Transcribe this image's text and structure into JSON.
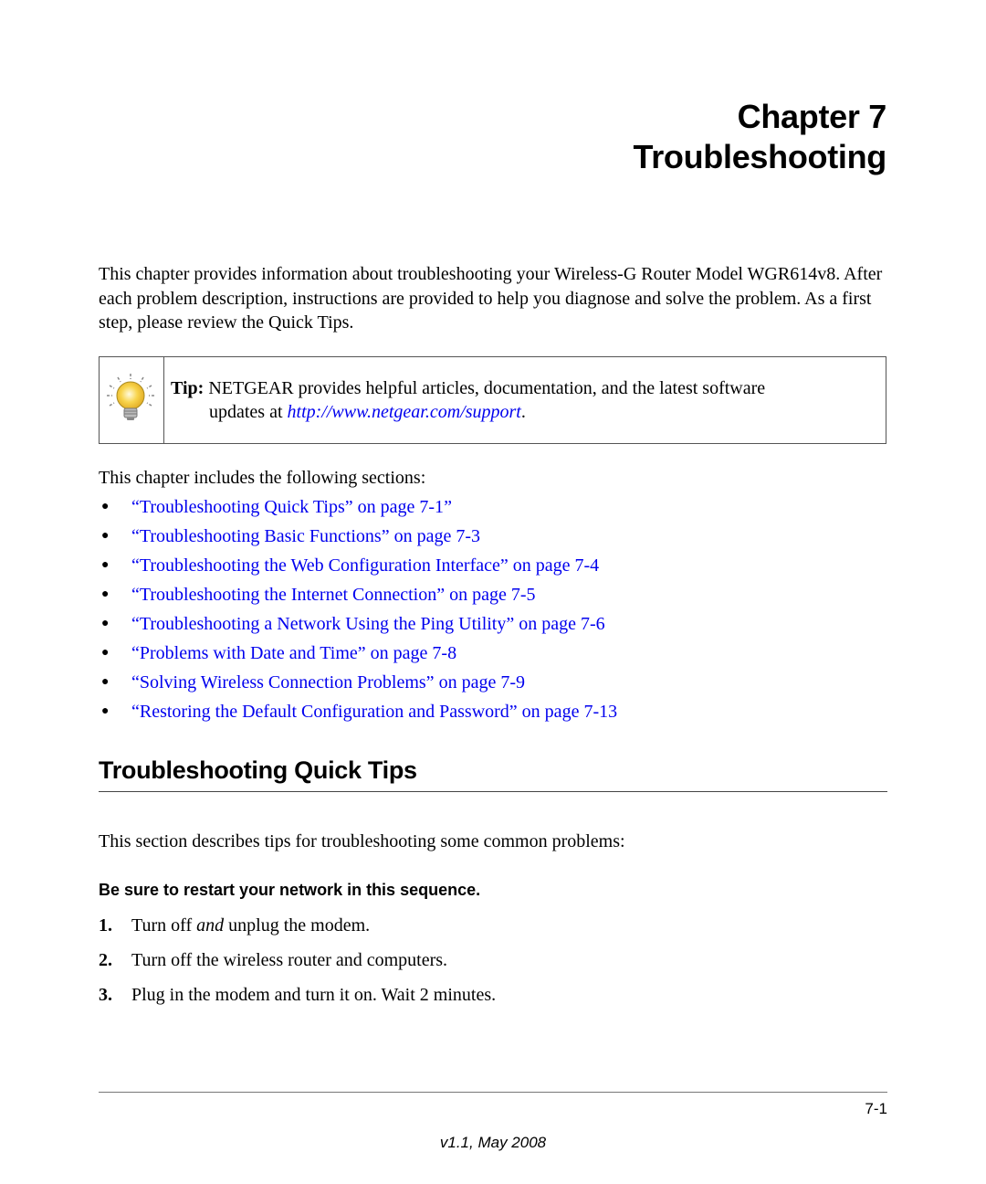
{
  "chapter": {
    "label": "Chapter 7",
    "title": "Troubleshooting"
  },
  "intro": "This chapter provides information about troubleshooting your Wireless-G Router Model WGR614v8. After each problem description, instructions are provided to help you diagnose and solve the problem. As a first step, please review the Quick Tips.",
  "tip": {
    "icon": "lightbulb-icon",
    "label": "Tip:",
    "text": "NETGEAR provides helpful articles, documentation, and the latest software",
    "text2_prefix": "updates at ",
    "link": "http://www.netgear.com/support",
    "text2_suffix": "."
  },
  "sections_intro": "This chapter includes the following sections:",
  "toc": [
    {
      "title": "“Troubleshooting Quick Tips” on page ",
      "page": "7-1",
      "suffix": "”"
    },
    {
      "title": "“Troubleshooting Basic Functions” on page ",
      "page": "7-3",
      "suffix": ""
    },
    {
      "title": "“Troubleshooting the Web Configuration Interface” on page ",
      "page": "7-4",
      "suffix": ""
    },
    {
      "title": "“Troubleshooting the Internet Connection” on page ",
      "page": "7-5",
      "suffix": ""
    },
    {
      "title": "“Troubleshooting a Network Using the Ping Utility” on page ",
      "page": "7-6",
      "suffix": ""
    },
    {
      "title": "“Problems with Date and Time” on page ",
      "page": "7-8",
      "suffix": ""
    },
    {
      "title": "“Solving Wireless Connection Problems” on page ",
      "page": "7-9",
      "suffix": ""
    },
    {
      "title": "“Restoring the Default Configuration and Password” on page ",
      "page": "7-13",
      "suffix": ""
    }
  ],
  "quick_tips": {
    "heading": "Troubleshooting Quick Tips",
    "description": "This section describes tips for troubleshooting some common problems:",
    "subheading": "Be sure to restart your network in this sequence.",
    "steps": [
      {
        "num": "1.",
        "pre": "Turn off ",
        "em": "and",
        "post": " unplug the modem."
      },
      {
        "num": "2.",
        "pre": "Turn off the wireless router and computers.",
        "em": "",
        "post": ""
      },
      {
        "num": "3.",
        "pre": "Plug in the modem and turn it on. Wait 2 minutes.",
        "em": "",
        "post": ""
      }
    ]
  },
  "footer": {
    "page_number": "7-1",
    "version": "v1.1, May 2008"
  },
  "colors": {
    "link": "#0000ee",
    "text": "#000000",
    "bulb": "#f5c842"
  }
}
